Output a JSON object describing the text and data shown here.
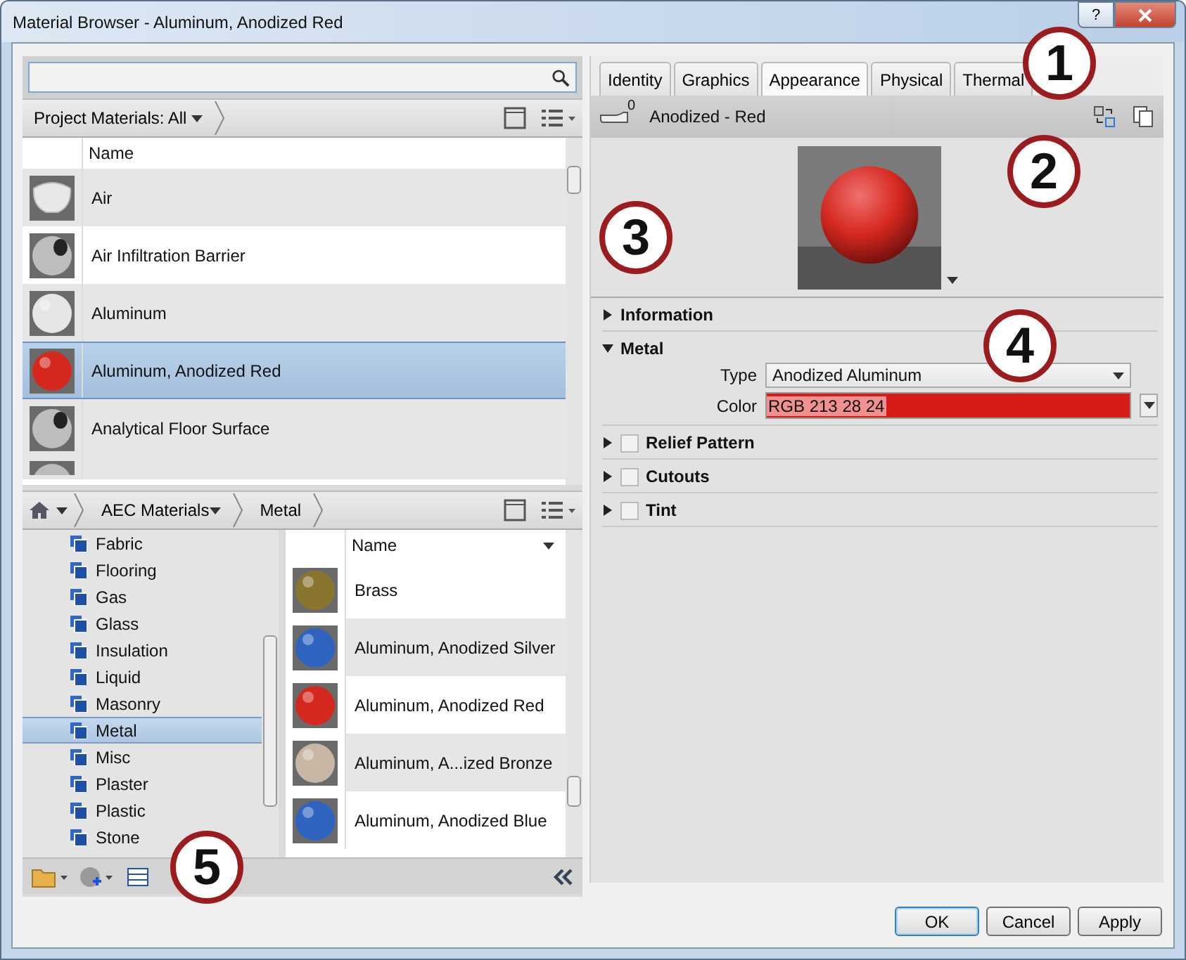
{
  "window": {
    "title": "Material Browser - Aluminum, Anodized Red",
    "help_label": "?"
  },
  "project_library": {
    "breadcrumb": "Project Materials: All",
    "column": "Name",
    "rows": [
      {
        "name": "Air",
        "kind": "cloud",
        "color": "#e8e8e8",
        "selected": false
      },
      {
        "name": "Air Infiltration Barrier",
        "kind": "shaderball",
        "color": "#bdbdbd",
        "selected": false
      },
      {
        "name": "Aluminum",
        "kind": "sphere",
        "color": "#e6e6e6",
        "selected": false
      },
      {
        "name": "Aluminum, Anodized Red",
        "kind": "sphere",
        "color": "#d5281f",
        "selected": true
      },
      {
        "name": "Analytical Floor Surface",
        "kind": "shaderball",
        "color": "#bdbdbd",
        "selected": false
      }
    ]
  },
  "aec_library": {
    "breadcrumb": [
      "AEC Materials",
      "Metal"
    ],
    "categories": [
      {
        "name": "Fabric",
        "selected": false
      },
      {
        "name": "Flooring",
        "selected": false
      },
      {
        "name": "Gas",
        "selected": false
      },
      {
        "name": "Glass",
        "selected": false
      },
      {
        "name": "Insulation",
        "selected": false
      },
      {
        "name": "Liquid",
        "selected": false
      },
      {
        "name": "Masonry",
        "selected": false
      },
      {
        "name": "Metal",
        "selected": true
      },
      {
        "name": "Misc",
        "selected": false
      },
      {
        "name": "Plaster",
        "selected": false
      },
      {
        "name": "Plastic",
        "selected": false
      },
      {
        "name": "Stone",
        "selected": false
      }
    ],
    "column": "Name",
    "materials": [
      {
        "name": "Brass",
        "color": "#8a7530"
      },
      {
        "name": "Aluminum, Anodized Silver",
        "color": "#2f63c0"
      },
      {
        "name": "Aluminum, Anodized Red",
        "color": "#d5281f"
      },
      {
        "name": "Aluminum, A...ized Bronze",
        "color": "#c9b7a5"
      },
      {
        "name": "Aluminum, Anodized Blue",
        "color": "#2f63c0"
      }
    ]
  },
  "tabs": [
    {
      "label": "Identity",
      "selected": false
    },
    {
      "label": "Graphics",
      "selected": false
    },
    {
      "label": "Appearance",
      "selected": true
    },
    {
      "label": "Physical",
      "selected": false
    },
    {
      "label": "Thermal",
      "selected": false
    }
  ],
  "asset": {
    "count": "0",
    "name": "Anodized - Red"
  },
  "sections": [
    {
      "title": "Information",
      "kind": "plain",
      "expanded": false
    },
    {
      "title": "Metal",
      "kind": "plain",
      "expanded": true,
      "fields": [
        {
          "label": "Type",
          "kind": "dropdown",
          "value": "Anodized Aluminum"
        },
        {
          "label": "Color",
          "kind": "color",
          "value": "RGB 213 28 24",
          "color": "#d51c18"
        }
      ]
    },
    {
      "title": "Relief Pattern",
      "kind": "toggle",
      "expanded": false,
      "checked": false
    },
    {
      "title": "Cutouts",
      "kind": "toggle",
      "expanded": false,
      "checked": false
    },
    {
      "title": "Tint",
      "kind": "toggle",
      "expanded": false,
      "checked": false
    }
  ],
  "buttons": [
    {
      "label": "OK",
      "default": true
    },
    {
      "label": "Cancel",
      "default": false
    },
    {
      "label": "Apply",
      "default": false
    }
  ],
  "callouts": [
    "1",
    "2",
    "3",
    "4",
    "5"
  ]
}
